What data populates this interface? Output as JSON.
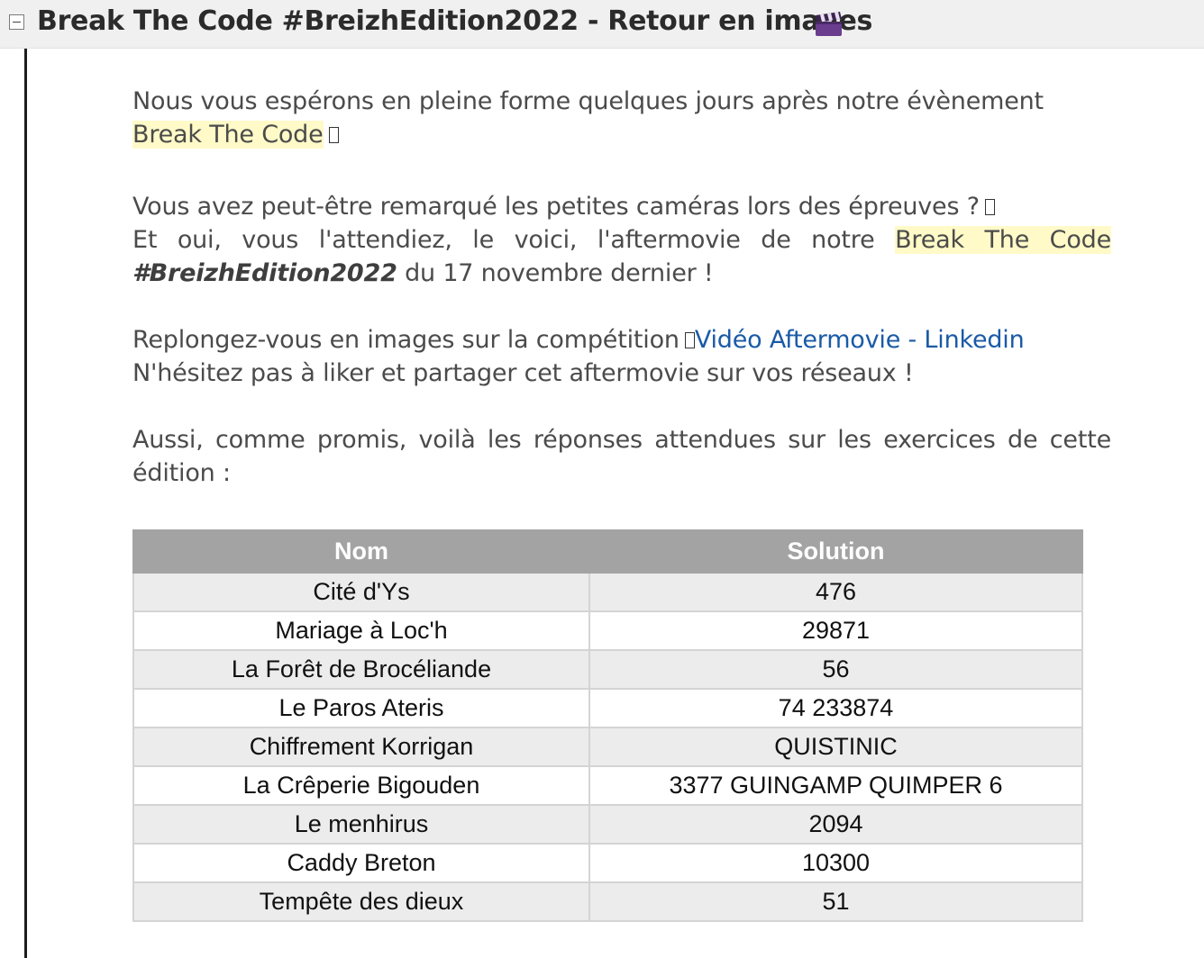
{
  "header": {
    "title": "Break The Code #BreizhEdition2022 - Retour en images",
    "title_icon": "clapper-board-icon",
    "toggle_icon": "collapse-minus-icon"
  },
  "message": {
    "p1_before": "Nous vous espérons en pleine forme quelques jours après notre évènement ",
    "p1_highlight": "Break The Code",
    "p2_line1": "Vous avez peut-être remarqué les petites caméras lors des épreuves ?",
    "p2_line2_before": "Et oui, vous l'attendiez, le voici, l'aftermovie de notre ",
    "p2_highlight": "Break The Code",
    "p2_emphasis": "#BreizhEdition2022",
    "p2_after": " du 17 novembre dernier !",
    "p3_before": "Replongez-vous en images sur la compétition",
    "p3_link": "Vidéo Aftermovie - Linkedin",
    "p3_line2": "N'hésitez pas à liker et partager cet aftermovie sur vos réseaux !",
    "p4": "Aussi, comme promis, voilà les réponses attendues sur les exercices de cette édition :"
  },
  "table": {
    "headers": [
      "Nom",
      "Solution"
    ],
    "rows": [
      [
        "Cité d'Ys",
        "476"
      ],
      [
        "Mariage à Loc'h",
        "29871"
      ],
      [
        "La Forêt de Brocéliande",
        "56"
      ],
      [
        "Le Paros Ateris",
        "74 233874"
      ],
      [
        "Chiffrement Korrigan",
        "QUISTINIC"
      ],
      [
        "La Crêperie Bigouden",
        "3377 GUINGAMP QUIMPER 6"
      ],
      [
        "Le menhirus",
        "2094"
      ],
      [
        "Caddy Breton",
        "10300"
      ],
      [
        "Tempête des dieux",
        "51"
      ]
    ]
  },
  "colors": {
    "highlight": "#fffac8",
    "link": "#1a5aa6",
    "table_header": "#a3a3a3",
    "header_bar": "#f0f0f0"
  }
}
